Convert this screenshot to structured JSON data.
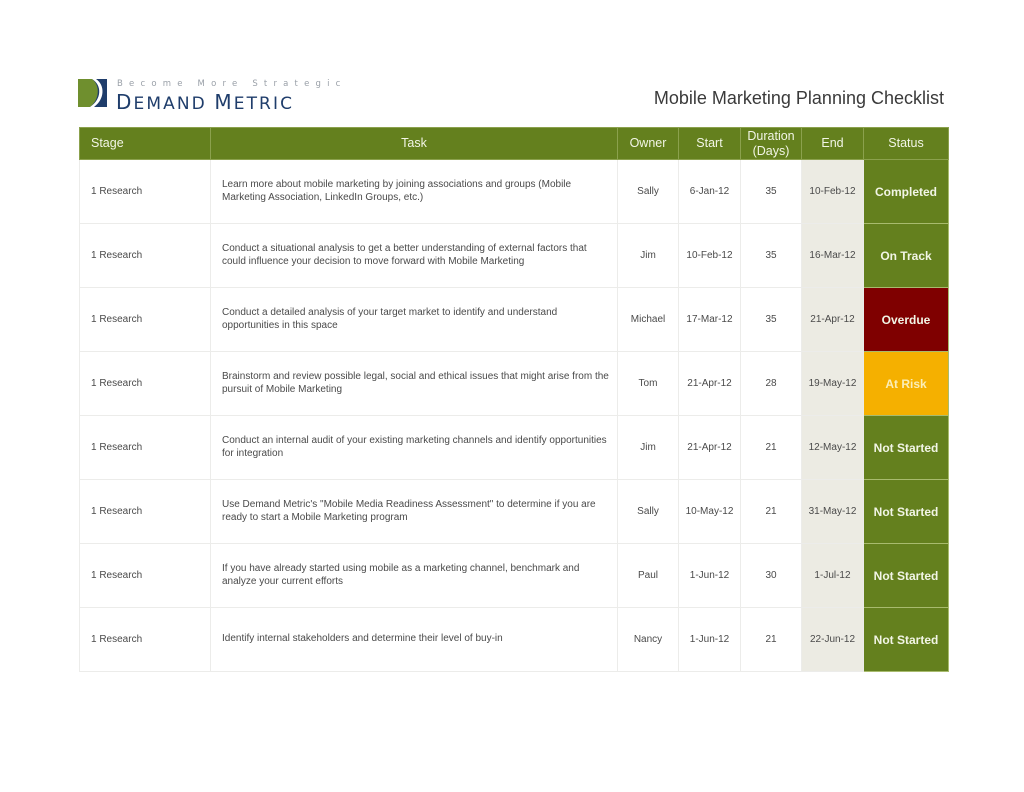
{
  "brand": {
    "tagline": "Become More Strategic",
    "name": "Demand Metric",
    "colors": {
      "mark_green": "#6f8f2e",
      "mark_navy": "#1f3d6b"
    }
  },
  "document": {
    "title": "Mobile Marketing Planning Checklist"
  },
  "table": {
    "headers": {
      "stage": "Stage",
      "task": "Task",
      "owner": "Owner",
      "start": "Start",
      "duration_line1": "Duration",
      "duration_line2": "(Days)",
      "end": "End",
      "status": "Status"
    },
    "status_colors": {
      "Completed": "#64801e",
      "On Track": "#64801e",
      "Overdue": "#7f0000",
      "At Risk": "#f5b000",
      "Not Started": "#64801e"
    },
    "rows": [
      {
        "stage": "1 Research",
        "task": "Learn more about mobile marketing by joining associations and groups (Mobile Marketing Association, LinkedIn Groups, etc.)",
        "owner": "Sally",
        "start": "6-Jan-12",
        "duration": "35",
        "end": "10-Feb-12",
        "status": "Completed"
      },
      {
        "stage": "1 Research",
        "task": "Conduct a situational analysis to get a better understanding of external factors that could influence your decision to move forward with Mobile Marketing",
        "owner": "Jim",
        "start": "10-Feb-12",
        "duration": "35",
        "end": "16-Mar-12",
        "status": "On Track"
      },
      {
        "stage": "1 Research",
        "task": "Conduct a detailed analysis of your target market to identify and understand opportunities in this space",
        "owner": "Michael",
        "start": "17-Mar-12",
        "duration": "35",
        "end": "21-Apr-12",
        "status": "Overdue"
      },
      {
        "stage": "1 Research",
        "task": "Brainstorm and review possible legal, social and ethical issues that might arise from the pursuit of Mobile Marketing",
        "owner": "Tom",
        "start": "21-Apr-12",
        "duration": "28",
        "end": "19-May-12",
        "status": "At Risk"
      },
      {
        "stage": "1 Research",
        "task": "Conduct an internal audit of your existing marketing channels and identify opportunities for integration",
        "owner": "Jim",
        "start": "21-Apr-12",
        "duration": "21",
        "end": "12-May-12",
        "status": "Not Started"
      },
      {
        "stage": "1 Research",
        "task": "Use Demand Metric's \"Mobile Media Readiness Assessment\" to determine if you are ready to start a Mobile Marketing program",
        "owner": "Sally",
        "start": "10-May-12",
        "duration": "21",
        "end": "31-May-12",
        "status": "Not Started"
      },
      {
        "stage": "1 Research",
        "task": "If you have already started using mobile as a marketing channel, benchmark and analyze your current efforts",
        "owner": "Paul",
        "start": "1-Jun-12",
        "duration": "30",
        "end": "1-Jul-12",
        "status": "Not Started"
      },
      {
        "stage": "1 Research",
        "task": "Identify internal stakeholders and determine their level of buy-in",
        "owner": "Nancy",
        "start": "1-Jun-12",
        "duration": "21",
        "end": "22-Jun-12",
        "status": "Not Started"
      }
    ]
  }
}
